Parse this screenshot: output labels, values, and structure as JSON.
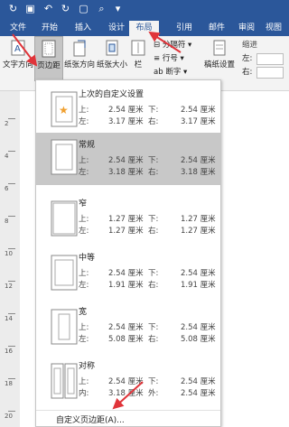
{
  "quick_access": {
    "icons": [
      "autosave-icon",
      "save-icon",
      "undo-icon",
      "redo-icon",
      "new-doc-icon",
      "search-icon",
      "customize-icon"
    ]
  },
  "tabs": [
    "文件",
    "开始",
    "插入",
    "设计",
    "布局",
    "引用",
    "邮件",
    "审阅",
    "视图"
  ],
  "active_tab": "布局",
  "ribbon": {
    "text_direction": "文字方向",
    "margins": "页边距",
    "orientation": "纸张方向",
    "size": "纸张大小",
    "columns": "栏",
    "breaks": "分隔符",
    "line_numbers": "行号",
    "hyphenation": "断字",
    "paper_setup": "稿纸设置",
    "indent_label": "缩进",
    "indent_left": "左:",
    "indent_right": "右:"
  },
  "margins_menu": {
    "presets": [
      {
        "name": "上次的自定义设置",
        "row1": [
          "上:",
          "2.54 厘米",
          "下:",
          "2.54 厘米"
        ],
        "row2": [
          "左:",
          "3.17 厘米",
          "右:",
          "3.17 厘米"
        ]
      },
      {
        "name": "常规",
        "row1": [
          "上:",
          "2.54 厘米",
          "下:",
          "2.54 厘米"
        ],
        "row2": [
          "左:",
          "3.18 厘米",
          "右:",
          "3.18 厘米"
        ]
      },
      {
        "name": "窄",
        "row1": [
          "上:",
          "1.27 厘米",
          "下:",
          "1.27 厘米"
        ],
        "row2": [
          "左:",
          "1.27 厘米",
          "右:",
          "1.27 厘米"
        ]
      },
      {
        "name": "中等",
        "row1": [
          "上:",
          "2.54 厘米",
          "下:",
          "2.54 厘米"
        ],
        "row2": [
          "左:",
          "1.91 厘米",
          "右:",
          "1.91 厘米"
        ]
      },
      {
        "name": "宽",
        "row1": [
          "上:",
          "2.54 厘米",
          "下:",
          "2.54 厘米"
        ],
        "row2": [
          "左:",
          "5.08 厘米",
          "右:",
          "5.08 厘米"
        ]
      },
      {
        "name": "对称",
        "row1": [
          "上:",
          "2.54 厘米",
          "下:",
          "2.54 厘米"
        ],
        "row2": [
          "内:",
          "3.18 厘米",
          "外:",
          "2.54 厘米"
        ]
      }
    ],
    "custom": "自定义页边距(A)..."
  },
  "ruler_numbers": [
    "2",
    "4",
    "6",
    "8",
    "10",
    "12",
    "14",
    "16",
    "18",
    "20"
  ],
  "colors": {
    "brand": "#2b579a",
    "highlight": "#c8c8c8",
    "arrow": "#e0343a"
  }
}
